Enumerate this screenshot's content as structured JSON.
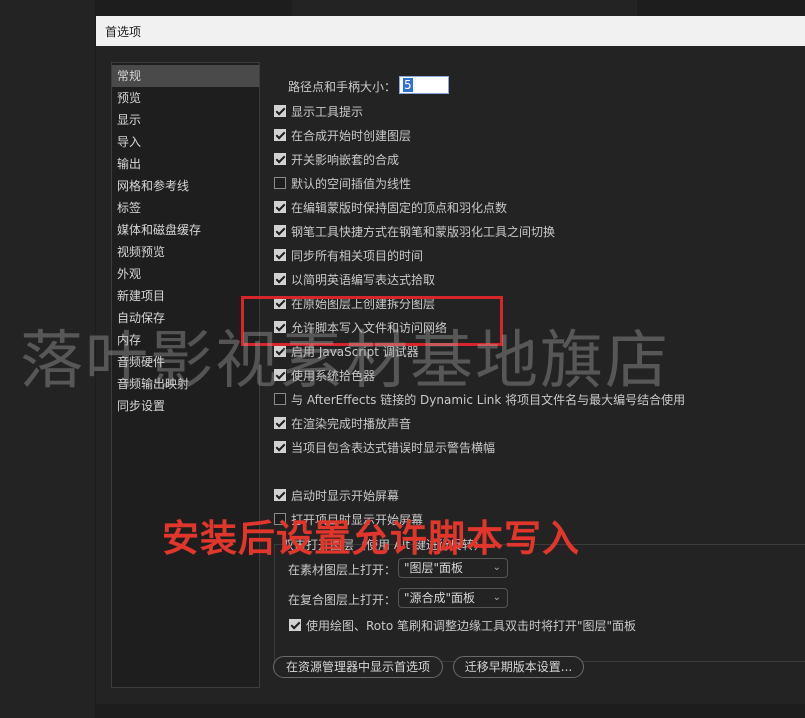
{
  "dialog": {
    "title": "首选项"
  },
  "sidebar": {
    "items": [
      {
        "label": "常规",
        "selected": true
      },
      {
        "label": "预览",
        "selected": false
      },
      {
        "label": "显示",
        "selected": false
      },
      {
        "label": "导入",
        "selected": false
      },
      {
        "label": "输出",
        "selected": false
      },
      {
        "label": "网格和参考线",
        "selected": false
      },
      {
        "label": "标签",
        "selected": false
      },
      {
        "label": "媒体和磁盘缓存",
        "selected": false
      },
      {
        "label": "视频预览",
        "selected": false
      },
      {
        "label": "外观",
        "selected": false
      },
      {
        "label": "新建项目",
        "selected": false
      },
      {
        "label": "自动保存",
        "selected": false
      },
      {
        "label": "内存",
        "selected": false
      },
      {
        "label": "音频硬件",
        "selected": false
      },
      {
        "label": "音频输出映射",
        "selected": false
      },
      {
        "label": "同步设置",
        "selected": false
      }
    ]
  },
  "general": {
    "handle_size_label": "路径点和手柄大小：",
    "handle_size_value": "5",
    "options": [
      {
        "label": "显示工具提示",
        "checked": true
      },
      {
        "label": "在合成开始时创建图层",
        "checked": true
      },
      {
        "label": "开关影响嵌套的合成",
        "checked": true
      },
      {
        "label": "默认的空间插值为线性",
        "checked": false
      },
      {
        "label": "在编辑蒙版时保持固定的顶点和羽化点数",
        "checked": true
      },
      {
        "label": "钢笔工具快捷方式在钢笔和蒙版羽化工具之间切换",
        "checked": true
      },
      {
        "label": "同步所有相关项目的时间",
        "checked": true
      },
      {
        "label": "以简明英语编写表达式拾取",
        "checked": true
      },
      {
        "label": "在原始图层上创建拆分图层",
        "checked": true
      },
      {
        "label": "允许脚本写入文件和访问网络",
        "checked": true
      },
      {
        "label": "启用 JavaScript 调试器",
        "checked": true
      },
      {
        "label": "使用系统拾色器",
        "checked": true
      },
      {
        "label": "与 AfterEffects 链接的 Dynamic Link 将项目文件名与最大编号结合使用",
        "checked": false
      },
      {
        "label": "在渲染完成时播放声音",
        "checked": true
      },
      {
        "label": "当项目包含表达式错误时显示警告横幅",
        "checked": true
      }
    ],
    "startup_options": [
      {
        "label": "启动时显示开始屏幕",
        "checked": true
      },
      {
        "label": "打开项目时显示开始屏幕",
        "checked": false
      }
    ],
    "doubleclick": {
      "header": "双击打开图层（使用 Alt 键进行反转）",
      "footage_label": "在素材图层上打开：",
      "footage_value": "\"图层\"面板",
      "comp_label": "在复合图层上打开：",
      "comp_value": "\"源合成\"面板",
      "paint_label": "使用绘图、Roto 笔刷和调整边缘工具双击时将打开\"图层\"面板",
      "paint_checked": true
    },
    "buttons": {
      "reveal": "在资源管理器中显示首选项",
      "migrate": "迁移早期版本设置..."
    }
  },
  "annotation": {
    "watermark": "落叶影视素材基地旗店",
    "caption": "安装后设置允许脚本写入"
  },
  "colors": {
    "highlight_box": "#d7262b",
    "caption": "#e0362c"
  }
}
